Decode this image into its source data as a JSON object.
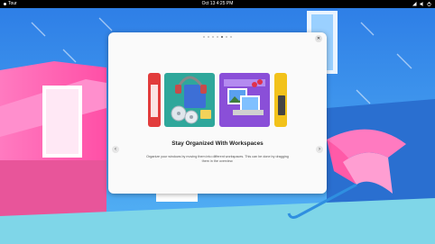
{
  "topbar": {
    "activities_label": "Tour",
    "clock": "Oct 13  4:25 PM"
  },
  "tour": {
    "page_count": 7,
    "current_page": 5,
    "title": "Stay Organized With Workspaces",
    "description": "Organize your windows by moving them into different workspaces. This can be done by dragging them in the overview.",
    "close_icon": "close-icon",
    "prev_icon": "chevron-left-icon",
    "next_icon": "chevron-right-icon"
  },
  "colors": {
    "sky": "#3a8fe8",
    "pink": "#ff69b4",
    "dialog_bg": "#fafafa"
  }
}
